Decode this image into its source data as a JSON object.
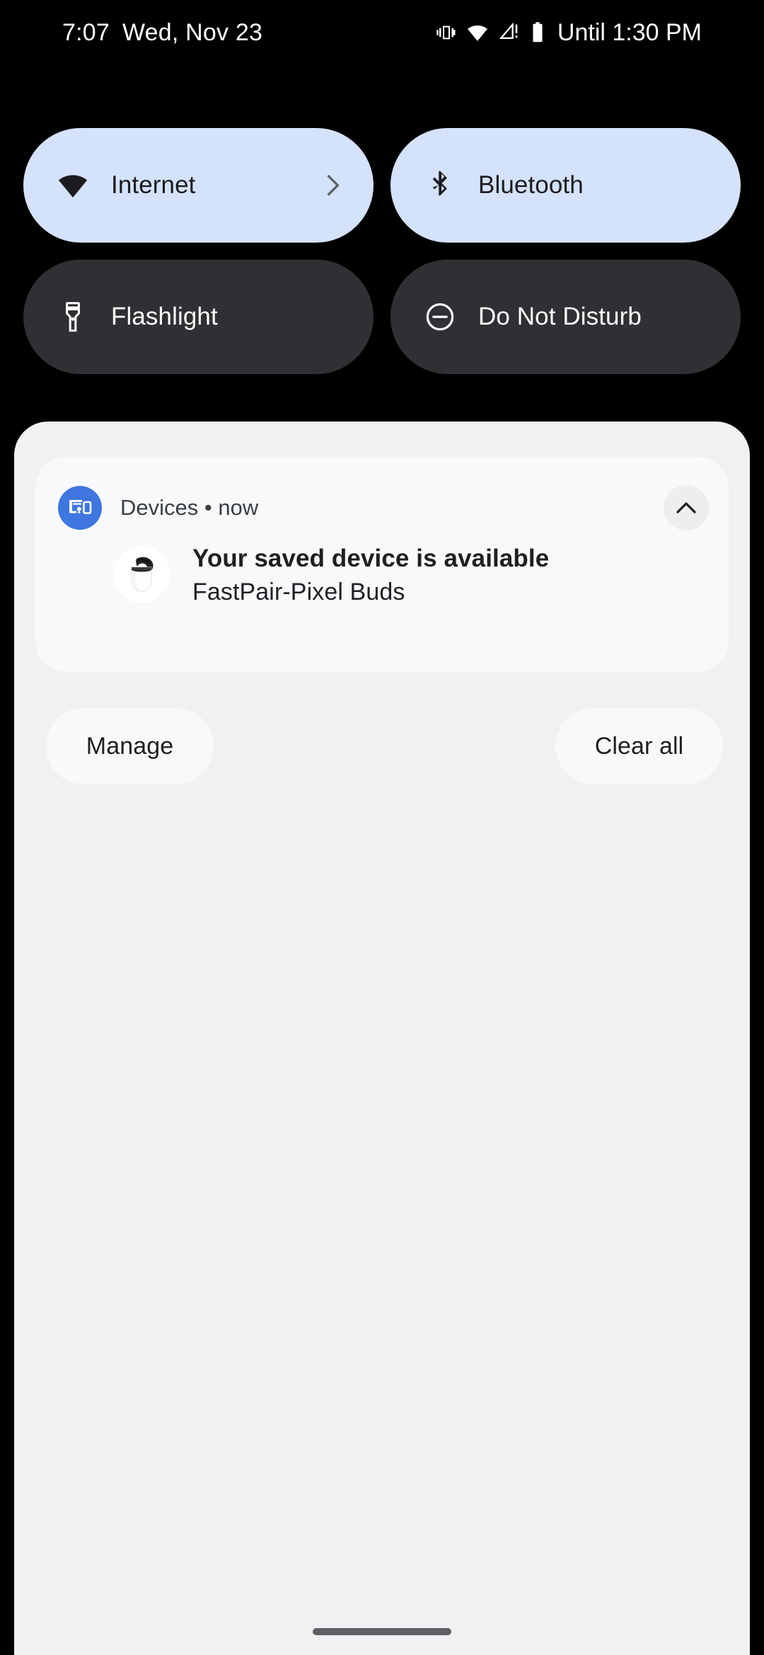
{
  "status_bar": {
    "time": "7:07",
    "date": "Wed, Nov 23",
    "icons": [
      "vibrate-icon",
      "wifi-icon",
      "cellular-no-sim-icon",
      "battery-icon"
    ],
    "battery_estimate": "Until 1:30 PM"
  },
  "quick_settings": {
    "tiles": [
      {
        "label": "Internet",
        "icon": "wifi-icon",
        "state": "active",
        "has_chevron": true
      },
      {
        "label": "Bluetooth",
        "icon": "bluetooth-icon",
        "state": "active",
        "has_chevron": false
      },
      {
        "label": "Flashlight",
        "icon": "flashlight-icon",
        "state": "inactive",
        "has_chevron": false
      },
      {
        "label": "Do Not Disturb",
        "icon": "do-not-disturb-icon",
        "state": "inactive",
        "has_chevron": false
      }
    ],
    "active_bg": "#d4e2fc",
    "active_fg": "#1c1b1f",
    "inactive_bg": "#2f3033",
    "inactive_fg": "#ffffff"
  },
  "notification_shade": {
    "panel_bg": "#f1f1f3",
    "notification": {
      "app_icon": "devices-icon",
      "app_icon_color": "#3f76df",
      "source_line": "Devices • now",
      "title": "Your saved device is available",
      "subtitle": "FastPair-Pixel Buds",
      "thumbnail": "pixel-buds-case-image",
      "collapse_icon": "chevron-up-icon"
    },
    "actions": {
      "manage_label": "Manage",
      "clear_all_label": "Clear all"
    }
  },
  "navigation": {
    "gesture_bar": "home-gesture-handle",
    "gesture_bar_color": "#5f6063"
  }
}
